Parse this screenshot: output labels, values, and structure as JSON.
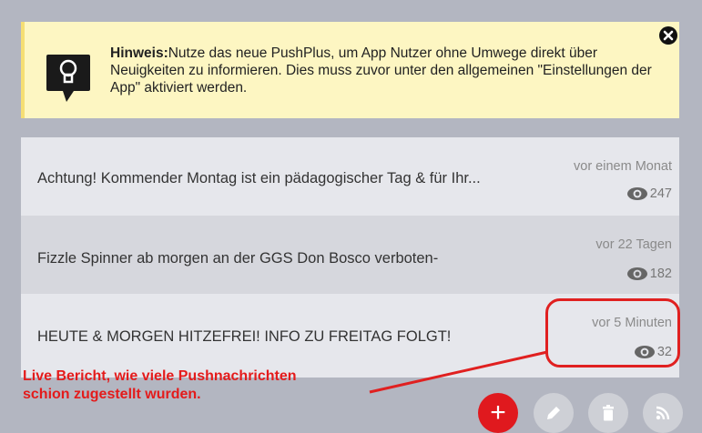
{
  "hint": {
    "label": "Hinweis:",
    "text": "Nutze das neue PushPlus, um App Nutzer ohne Umwege direkt über Neuigkeiten zu informieren. Dies muss zuvor unter den allgemeinen \"Einstellungen der App\" aktiviert werden.",
    "icon": "lightbulb-icon"
  },
  "messages": [
    {
      "title": "Achtung! Kommender Montag ist ein pädagogischer Tag & für Ihr...",
      "time": "vor einem Monat",
      "views": "247"
    },
    {
      "title": "Fizzle Spinner ab morgen an der GGS Don Bosco verboten-",
      "time": "vor 22 Tagen",
      "views": "182"
    },
    {
      "title": "HEUTE & MORGEN HITZEFREI! INFO ZU FREITAG FOLGT!",
      "time": "vor 5 Minuten",
      "views": "32"
    }
  ],
  "annotation": {
    "line1": "Live Bericht, wie viele Pushnachrichten",
    "line2": "schion zugestellt wurden."
  },
  "actions": {
    "add": "+",
    "edit_icon": "pencil-icon",
    "delete_icon": "trash-icon",
    "rss_icon": "rss-icon"
  },
  "colors": {
    "accent": "#e0191e",
    "hint_bg": "#fdf6c2",
    "annotation": "#e41b1b"
  }
}
